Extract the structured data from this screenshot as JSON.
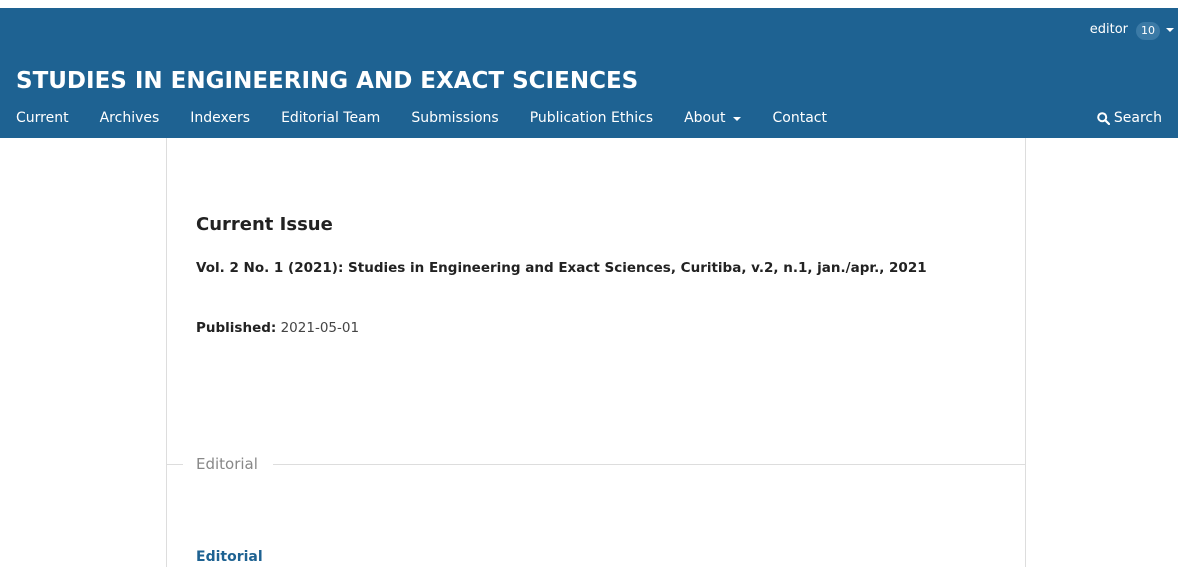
{
  "user": {
    "name": "editor",
    "count": "10"
  },
  "site": {
    "title": "STUDIES IN ENGINEERING AND EXACT SCIENCES"
  },
  "nav": {
    "items": [
      {
        "label": "Current"
      },
      {
        "label": "Archives"
      },
      {
        "label": "Indexers"
      },
      {
        "label": "Editorial Team"
      },
      {
        "label": "Submissions"
      },
      {
        "label": "Publication Ethics"
      },
      {
        "label": "About"
      },
      {
        "label": "Contact"
      }
    ],
    "search_label": "Search"
  },
  "main": {
    "heading": "Current Issue",
    "issue_title": "Vol. 2 No. 1 (2021): Studies in Engineering and Exact Sciences, Curitiba, v.2, n.1, jan./apr., 2021",
    "published_label": "Published:",
    "published_date": "2021-05-01",
    "section_label": "Editorial",
    "article_title": "Editorial"
  },
  "colors": {
    "header_bg": "#1e6292",
    "link": "#1e6292"
  },
  "icons": {
    "search": "search-icon",
    "dropdown": "chevron-down-icon"
  }
}
